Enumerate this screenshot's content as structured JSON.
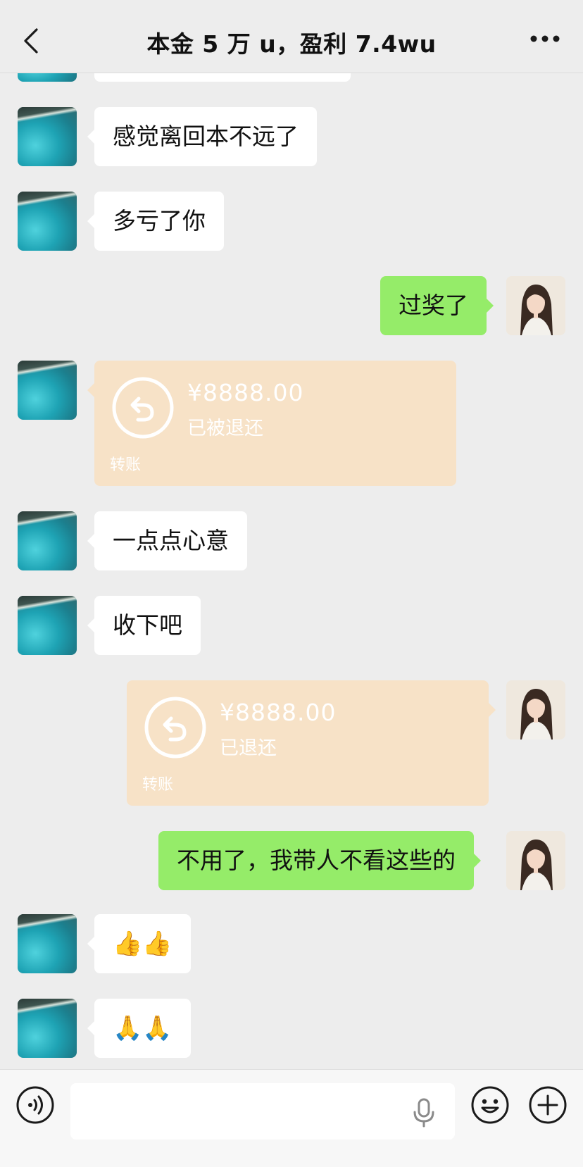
{
  "header": {
    "title": "本金 5 万 u，盈利 7.4wu",
    "back_icon": "chevron-left-icon",
    "more_icon": "ellipsis-icon"
  },
  "messages": [
    {
      "side": "in",
      "type": "text",
      "text": "感觉离回本不远了"
    },
    {
      "side": "in",
      "type": "text",
      "text": "多亏了你"
    },
    {
      "side": "out",
      "type": "text",
      "text": "过奖了"
    },
    {
      "side": "in",
      "type": "transfer",
      "amount": "¥8888.00",
      "status": "已被退还",
      "label": "转账"
    },
    {
      "side": "in",
      "type": "text",
      "text": "一点点心意"
    },
    {
      "side": "in",
      "type": "text",
      "text": "收下吧"
    },
    {
      "side": "out",
      "type": "transfer",
      "amount": "¥8888.00",
      "status": "已退还",
      "label": "转账"
    },
    {
      "side": "out",
      "type": "text",
      "text": "不用了，我带人不看这些的"
    },
    {
      "side": "in",
      "type": "emoji",
      "text": "👍👍"
    },
    {
      "side": "in",
      "type": "emoji",
      "text": "🙏🙏"
    }
  ],
  "input_bar": {
    "voice_icon": "voice-icon",
    "mic_icon": "microphone-icon",
    "emoji_icon": "emoji-icon",
    "plus_icon": "plus-icon"
  },
  "colors": {
    "background": "#ededed",
    "incoming_bubble": "#ffffff",
    "outgoing_bubble": "#95ec69",
    "transfer_card": "#f7e2c7"
  }
}
